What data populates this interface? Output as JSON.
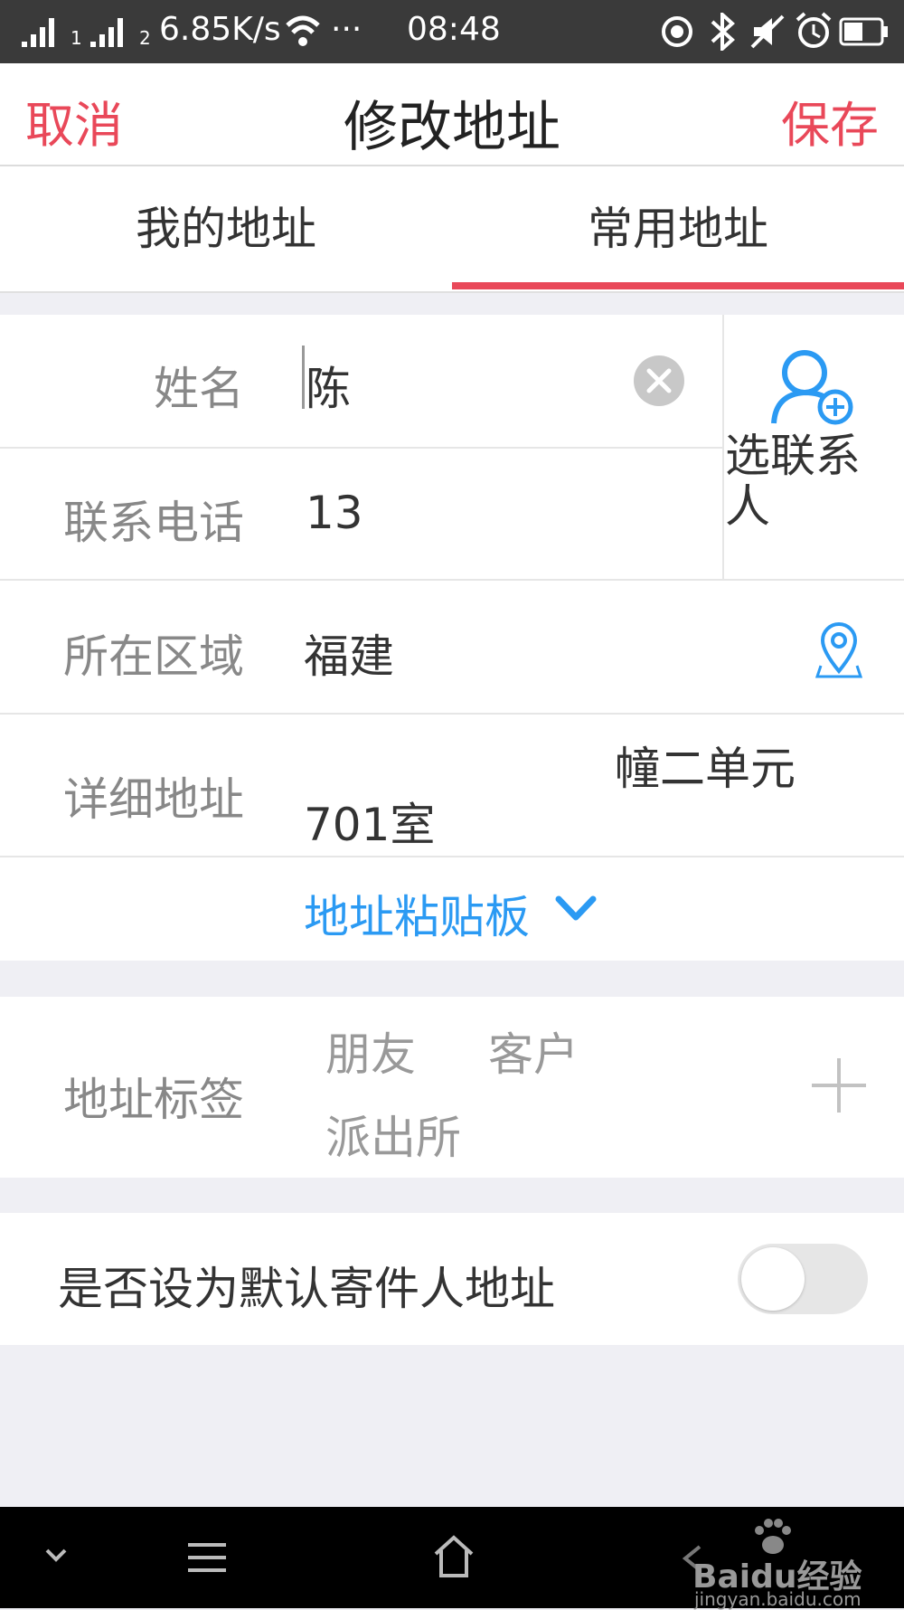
{
  "status_bar": {
    "sim1": "1",
    "sim2": "2",
    "speed": "6.85K/s",
    "more": "···",
    "time": "08:48"
  },
  "nav": {
    "cancel": "取消",
    "title": "修改地址",
    "save": "保存"
  },
  "tabs": [
    {
      "label": "我的地址",
      "active": false
    },
    {
      "label": "常用地址",
      "active": true
    }
  ],
  "form": {
    "name_label": "姓名",
    "name_value": "陈",
    "phone_label": "联系电话",
    "phone_value": "13",
    "contact_button": "选联系人",
    "region_label": "所在区域",
    "region_value": "福建",
    "detail_label": "详细地址",
    "detail_line1": "幢二单元",
    "detail_line2": "701室",
    "clipboard": "地址粘贴板"
  },
  "tags": {
    "label": "地址标签",
    "items": [
      "朋友",
      "客户",
      "派出所"
    ]
  },
  "default_setting": {
    "label": "是否设为默认寄件人地址",
    "enabled": false
  },
  "watermark": {
    "brand": "Baidu经验",
    "url": "jingyan.baidu.com"
  },
  "colors": {
    "accent_red": "#e94859",
    "accent_blue": "#2b9af3"
  }
}
